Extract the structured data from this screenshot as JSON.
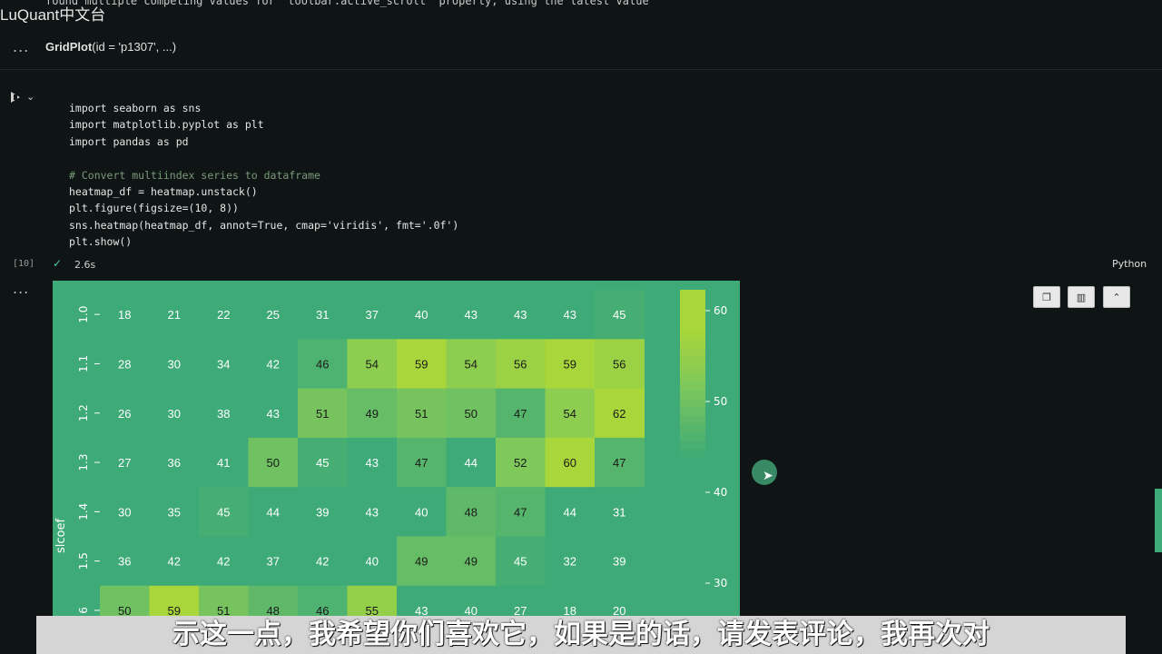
{
  "top_message": "found multiple competing values for 'toolbar.active_scroll' property; using the latest value",
  "brand": "LuQuant中文台",
  "output_cell": {
    "ellipsis": "...",
    "class_name": "GridPlot",
    "args": "(id = 'p1307', ...)"
  },
  "code_cell": {
    "lines": [
      "import seaborn as sns",
      "import matplotlib.pyplot as plt",
      "import pandas as pd",
      "",
      "# Convert multiindex series to dataframe",
      "heatmap_df = heatmap.unstack()",
      "plt.figure(figsize=(10, 8))",
      "sns.heatmap(heatmap_df, annot=True, cmap='viridis', fmt='.0f')",
      "plt.show()"
    ],
    "exec_count": "[10]",
    "exec_time": "2.6s",
    "language": "Python"
  },
  "output_ellipsis": "...",
  "toolbar_icons": [
    "copy-icon",
    "bar-chart-icon",
    "pin-icon"
  ],
  "colors": {
    "cell_low": "#3eaa77",
    "cell_mid": "#7fc85a",
    "cell_high": "#a9d63a",
    "accent": "#4ec9a3"
  },
  "subtitle": "示这一点，我希望你们喜欢它，如果是的话，请发表评论，我再次对",
  "chart_data": {
    "type": "heatmap",
    "ylabel": "slcoef",
    "y_ticks": [
      "1.0",
      "1.1",
      "1.2",
      "1.3",
      "1.4",
      "1.5",
      "6"
    ],
    "values": [
      [
        18,
        21,
        22,
        25,
        31,
        37,
        40,
        43,
        43,
        43,
        45
      ],
      [
        28,
        30,
        34,
        42,
        46,
        54,
        59,
        54,
        56,
        59,
        56
      ],
      [
        26,
        30,
        38,
        43,
        51,
        49,
        51,
        50,
        47,
        54,
        62
      ],
      [
        27,
        36,
        41,
        50,
        45,
        43,
        47,
        44,
        52,
        60,
        47
      ],
      [
        30,
        35,
        45,
        44,
        39,
        43,
        40,
        48,
        47,
        44,
        31
      ],
      [
        36,
        42,
        42,
        37,
        42,
        40,
        49,
        49,
        45,
        32,
        39
      ],
      [
        50,
        59,
        51,
        48,
        46,
        55,
        43,
        40,
        27,
        18,
        20
      ]
    ],
    "colorbar_ticks": [
      60,
      50,
      40,
      30
    ],
    "colorbar_range": [
      25,
      62
    ]
  }
}
